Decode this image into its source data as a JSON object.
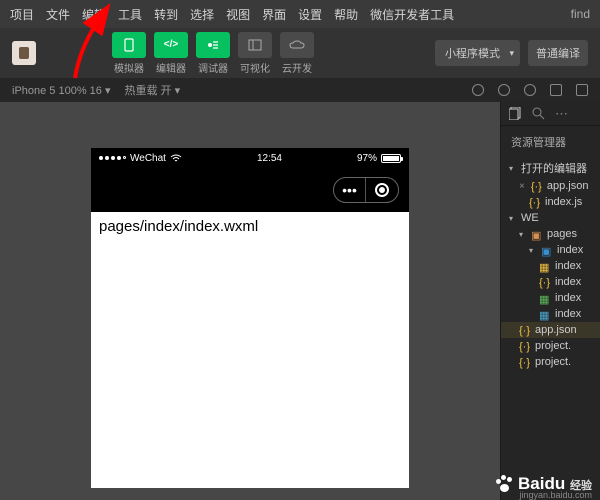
{
  "menubar": {
    "items": [
      "项目",
      "文件",
      "编辑",
      "工具",
      "转到",
      "选择",
      "视图",
      "界面",
      "设置",
      "帮助",
      "微信开发者工具"
    ],
    "right": "find"
  },
  "toolbar": {
    "tools": [
      {
        "label": "模拟器",
        "active": true
      },
      {
        "label": "编辑器",
        "active": true
      },
      {
        "label": "调试器",
        "active": true
      },
      {
        "label": "可视化",
        "active": false
      },
      {
        "label": "云开发",
        "active": false
      }
    ],
    "mode": "小程序模式",
    "compile": "普通编译"
  },
  "statusbar": {
    "device": "iPhone 5 100% 16",
    "reload": "热重载 开"
  },
  "phone": {
    "carrier": "WeChat",
    "time": "12:54",
    "battery": "97%",
    "content": "pages/index/index.wxml"
  },
  "sidebar": {
    "title": "资源管理器",
    "sections": {
      "open_editors": "打开的编辑器",
      "project": "WE"
    },
    "open_files": [
      {
        "name": "app.json",
        "modified": true
      },
      {
        "name": "index.js",
        "modified": false
      }
    ],
    "tree": {
      "pages": "pages",
      "index": "index",
      "files": [
        "index",
        "index",
        "index",
        "index"
      ],
      "root_files": [
        "app.json",
        "project.",
        "project."
      ]
    }
  },
  "watermark": {
    "brand": "Baidu",
    "product": "经验",
    "url": "jingyan.baidu.com"
  }
}
